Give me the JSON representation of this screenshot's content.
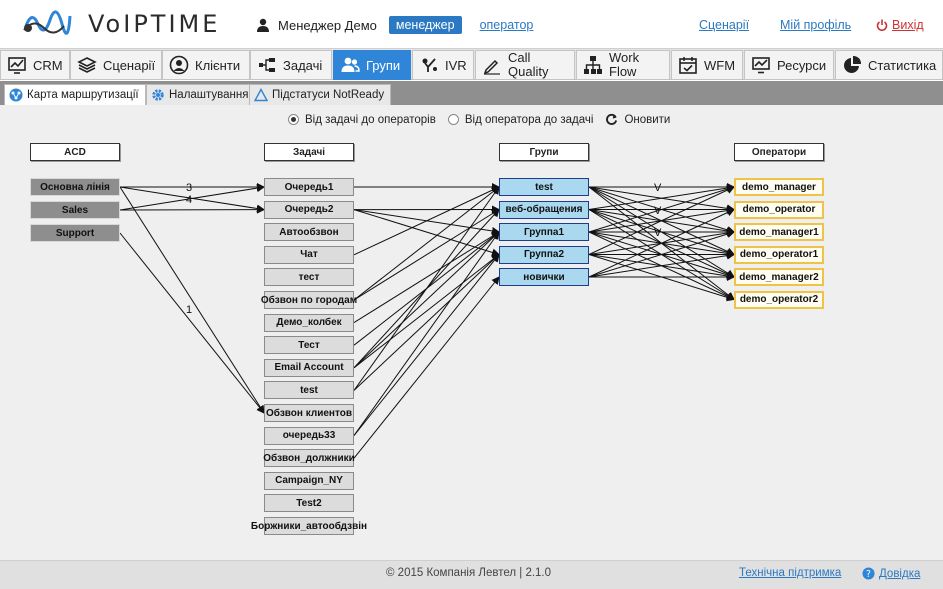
{
  "header": {
    "logo_text": "VoIPTIME",
    "user_name": "Менеджер Демо",
    "role_active": "менеджер",
    "role_other": "оператор",
    "links": {
      "scenarios": "Сценарії",
      "profile": "Мій профіль",
      "logout": "Вихід"
    }
  },
  "main_tabs": [
    {
      "label": "CRM",
      "icon": "chart-icon"
    },
    {
      "label": "Сценарії",
      "icon": "layers-icon"
    },
    {
      "label": "Клієнти",
      "icon": "person-icon"
    },
    {
      "label": "Задачі",
      "icon": "tasks-icon"
    },
    {
      "label": "Групи",
      "icon": "group-icon",
      "active": true
    },
    {
      "label": "IVR",
      "icon": "ivr-icon"
    },
    {
      "label": "Call Quality",
      "icon": "pen-icon"
    },
    {
      "label": "Work Flow",
      "icon": "workflow-icon"
    },
    {
      "label": "WFM",
      "icon": "calendar-icon"
    },
    {
      "label": "Ресурси",
      "icon": "monitor-icon"
    },
    {
      "label": "Статистика",
      "icon": "pie-icon"
    }
  ],
  "sub_tabs": [
    {
      "label": "Карта маршрутизації",
      "active": true
    },
    {
      "label": "Налаштування"
    },
    {
      "label": "Підстатуси NotReady"
    }
  ],
  "view": {
    "option_tasks_to_ops": "Від задачі до операторів",
    "option_op_to_tasks": "Від оператора до задачі",
    "refresh": "Оновити"
  },
  "columns": {
    "acd": "ACD",
    "tasks": "Задачі",
    "groups": "Групи",
    "operators": "Оператори"
  },
  "acd": [
    "Основна лінія",
    "Sales",
    "Support"
  ],
  "tasks": [
    "Очередь1",
    "Очередь2",
    "Автообзвон",
    "Чат",
    "тест",
    "Обзвон по городам",
    "Демо_колбек",
    "Тест",
    "Email Account",
    "test",
    "Обзвон клиентов",
    "очередь33",
    "Обзвон_должники",
    "Campaign_NY",
    "Test2",
    "Боржники_автообдзвін"
  ],
  "groups": [
    "test",
    "веб-обращения",
    "Группа1",
    "Группа2",
    "новички"
  ],
  "operators": [
    "demo_manager",
    "demo_operator",
    "demo_manager1",
    "demo_operator1",
    "demo_manager2",
    "demo_operator2"
  ],
  "link_labels": {
    "acd_main_q1": "3",
    "acd_main_q2": "4",
    "acd_main_clients": "1",
    "group_op": "V"
  },
  "footer": {
    "copyright": "© 2015 Компанія Левтел | 2.1.0",
    "support": "Технічна підтримка",
    "help": "Довідка"
  }
}
